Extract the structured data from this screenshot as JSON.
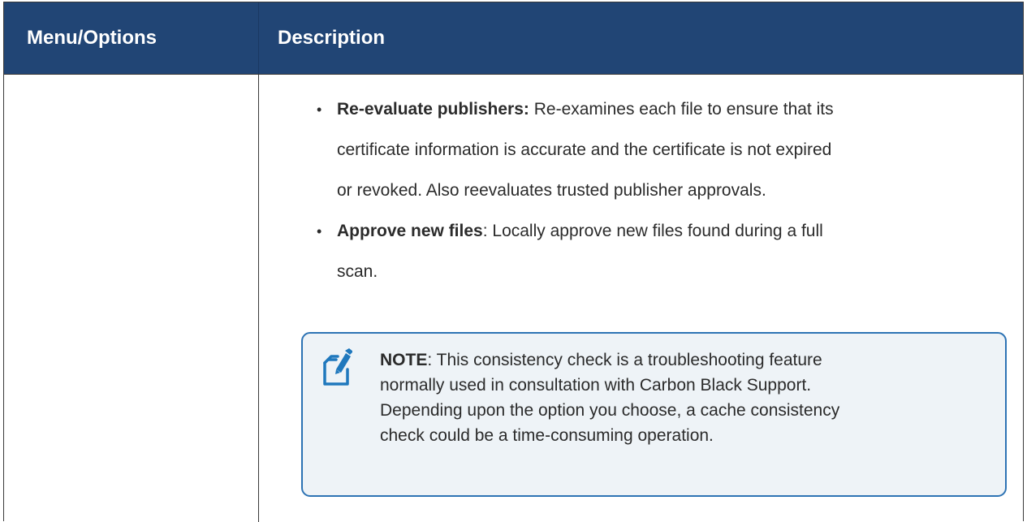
{
  "table": {
    "header": {
      "col1": "Menu/Options",
      "col2": "Description"
    },
    "bullets": [
      {
        "term": "Re-evaluate publishers:",
        "line1": " Re-examines each file to ensure that its",
        "line2": "certificate information is accurate and the certificate is not expired",
        "line3": "or revoked. Also reevaluates trusted publisher approvals."
      },
      {
        "term": "Approve new files",
        "line1": ": Locally approve new files found during a full",
        "line2": "scan."
      }
    ],
    "note": {
      "icon": "note-pencil-icon",
      "label": "NOTE",
      "line1": ": This consistency check is a troubleshooting feature",
      "line2": "normally used in consultation with Carbon Black Support.",
      "line3": "Depending upon the option you choose, a cache consistency",
      "line4": "check could be a time-consuming operation."
    }
  },
  "colors": {
    "header_bg": "#214575",
    "note_border": "#2d73b4",
    "note_bg": "#eef3f7"
  }
}
